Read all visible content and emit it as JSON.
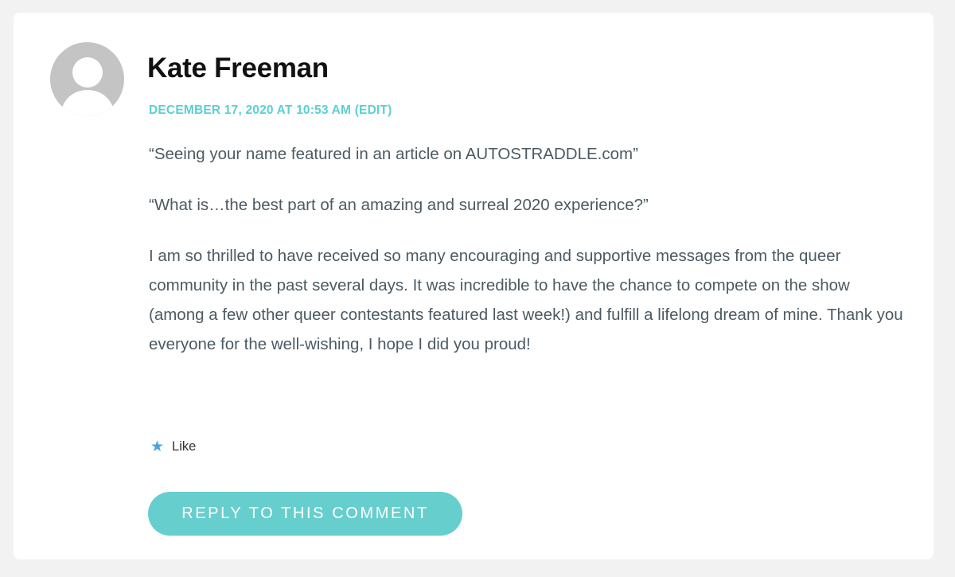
{
  "comment": {
    "author": "Kate Freeman",
    "date": "DECEMBER 17, 2020 AT 10:53 AM",
    "edit_label": "(EDIT)",
    "paragraphs": [
      "“Seeing your name featured in an article on AUTOSTRADDLE.com”",
      "“What is…the best part of an amazing and surreal 2020 experience?”",
      "I am so thrilled to have received so many encouraging and supportive messages from the queer community in the past several days. It was incredible to have the chance to compete on the show (among a few other queer contestants featured last week!) and fulfill a lifelong dream of mine. Thank you everyone for the well-wishing, I hope I did you proud!"
    ],
    "like": {
      "icon": "star-icon",
      "label": "Like"
    },
    "reply_label": "REPLY TO THIS COMMENT"
  },
  "colors": {
    "background": "#f2f2f3",
    "card": "#ffffff",
    "accent": "#5ccfd1",
    "button": "#66cfcd",
    "body_text": "#4c5a63",
    "star": "#4aa5d9",
    "avatar": "#c4c4c4"
  }
}
